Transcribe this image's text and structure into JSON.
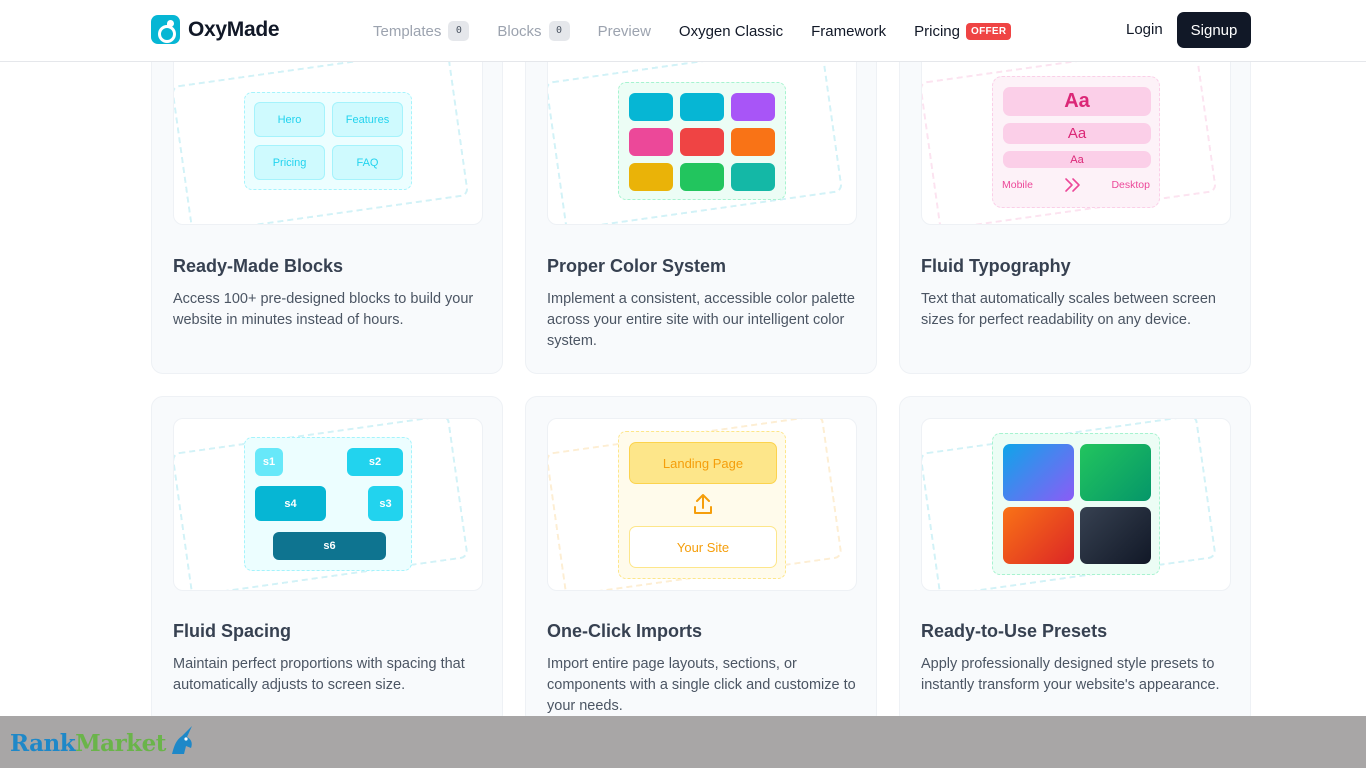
{
  "nav": {
    "logo_text": "OxyMade",
    "items": [
      {
        "label": "Templates",
        "badge": "0"
      },
      {
        "label": "Blocks",
        "badge": "0"
      },
      {
        "label": "Preview"
      },
      {
        "label": "Oxygen Classic"
      },
      {
        "label": "Framework"
      },
      {
        "label": "Pricing",
        "badge": "OFFER"
      }
    ],
    "login": "Login",
    "signup": "Signup"
  },
  "cards": [
    {
      "title": "Ready-Made Blocks",
      "description": "Access 100+ pre-designed blocks to build your website in minutes instead of hours.",
      "preview": {
        "blocks": [
          "Hero",
          "Features",
          "Pricing",
          "FAQ"
        ]
      }
    },
    {
      "title": "Proper Color System",
      "description": "Implement a consistent, accessible color palette across your entire site with our intelligent color system.",
      "preview": {
        "swatches": [
          "#06b6d4",
          "#06b6d4",
          "#a855f7",
          "#ec4899",
          "#ef4444",
          "#f97316",
          "#eab308",
          "#22c55e",
          "#14b8a6"
        ]
      }
    },
    {
      "title": "Fluid Typography",
      "description": "Text that automatically scales between screen sizes for perfect readability on any device.",
      "preview": {
        "samples": [
          "Aa",
          "Aa",
          "Aa"
        ],
        "left_label": "Mobile",
        "right_label": "Desktop"
      }
    },
    {
      "title": "Fluid Spacing",
      "description": "Maintain perfect proportions with spacing that automatically adjusts to screen size.",
      "preview": {
        "tokens": [
          "s1",
          "s2",
          "s4",
          "s3",
          "s6"
        ]
      }
    },
    {
      "title": "One-Click Imports",
      "description": "Import entire page layouts, sections, or components with a single click and customize to your needs.",
      "preview": {
        "source": "Landing Page",
        "target": "Your Site"
      }
    },
    {
      "title": "Ready-to-Use Presets",
      "description": "Apply professionally designed style presets to instantly transform your website's appearance.",
      "preview": {
        "presets": [
          "blue-purple",
          "green",
          "orange-red",
          "dark-slate"
        ]
      }
    }
  ],
  "watermark": {
    "part1": "Rank",
    "part2": "Market"
  }
}
